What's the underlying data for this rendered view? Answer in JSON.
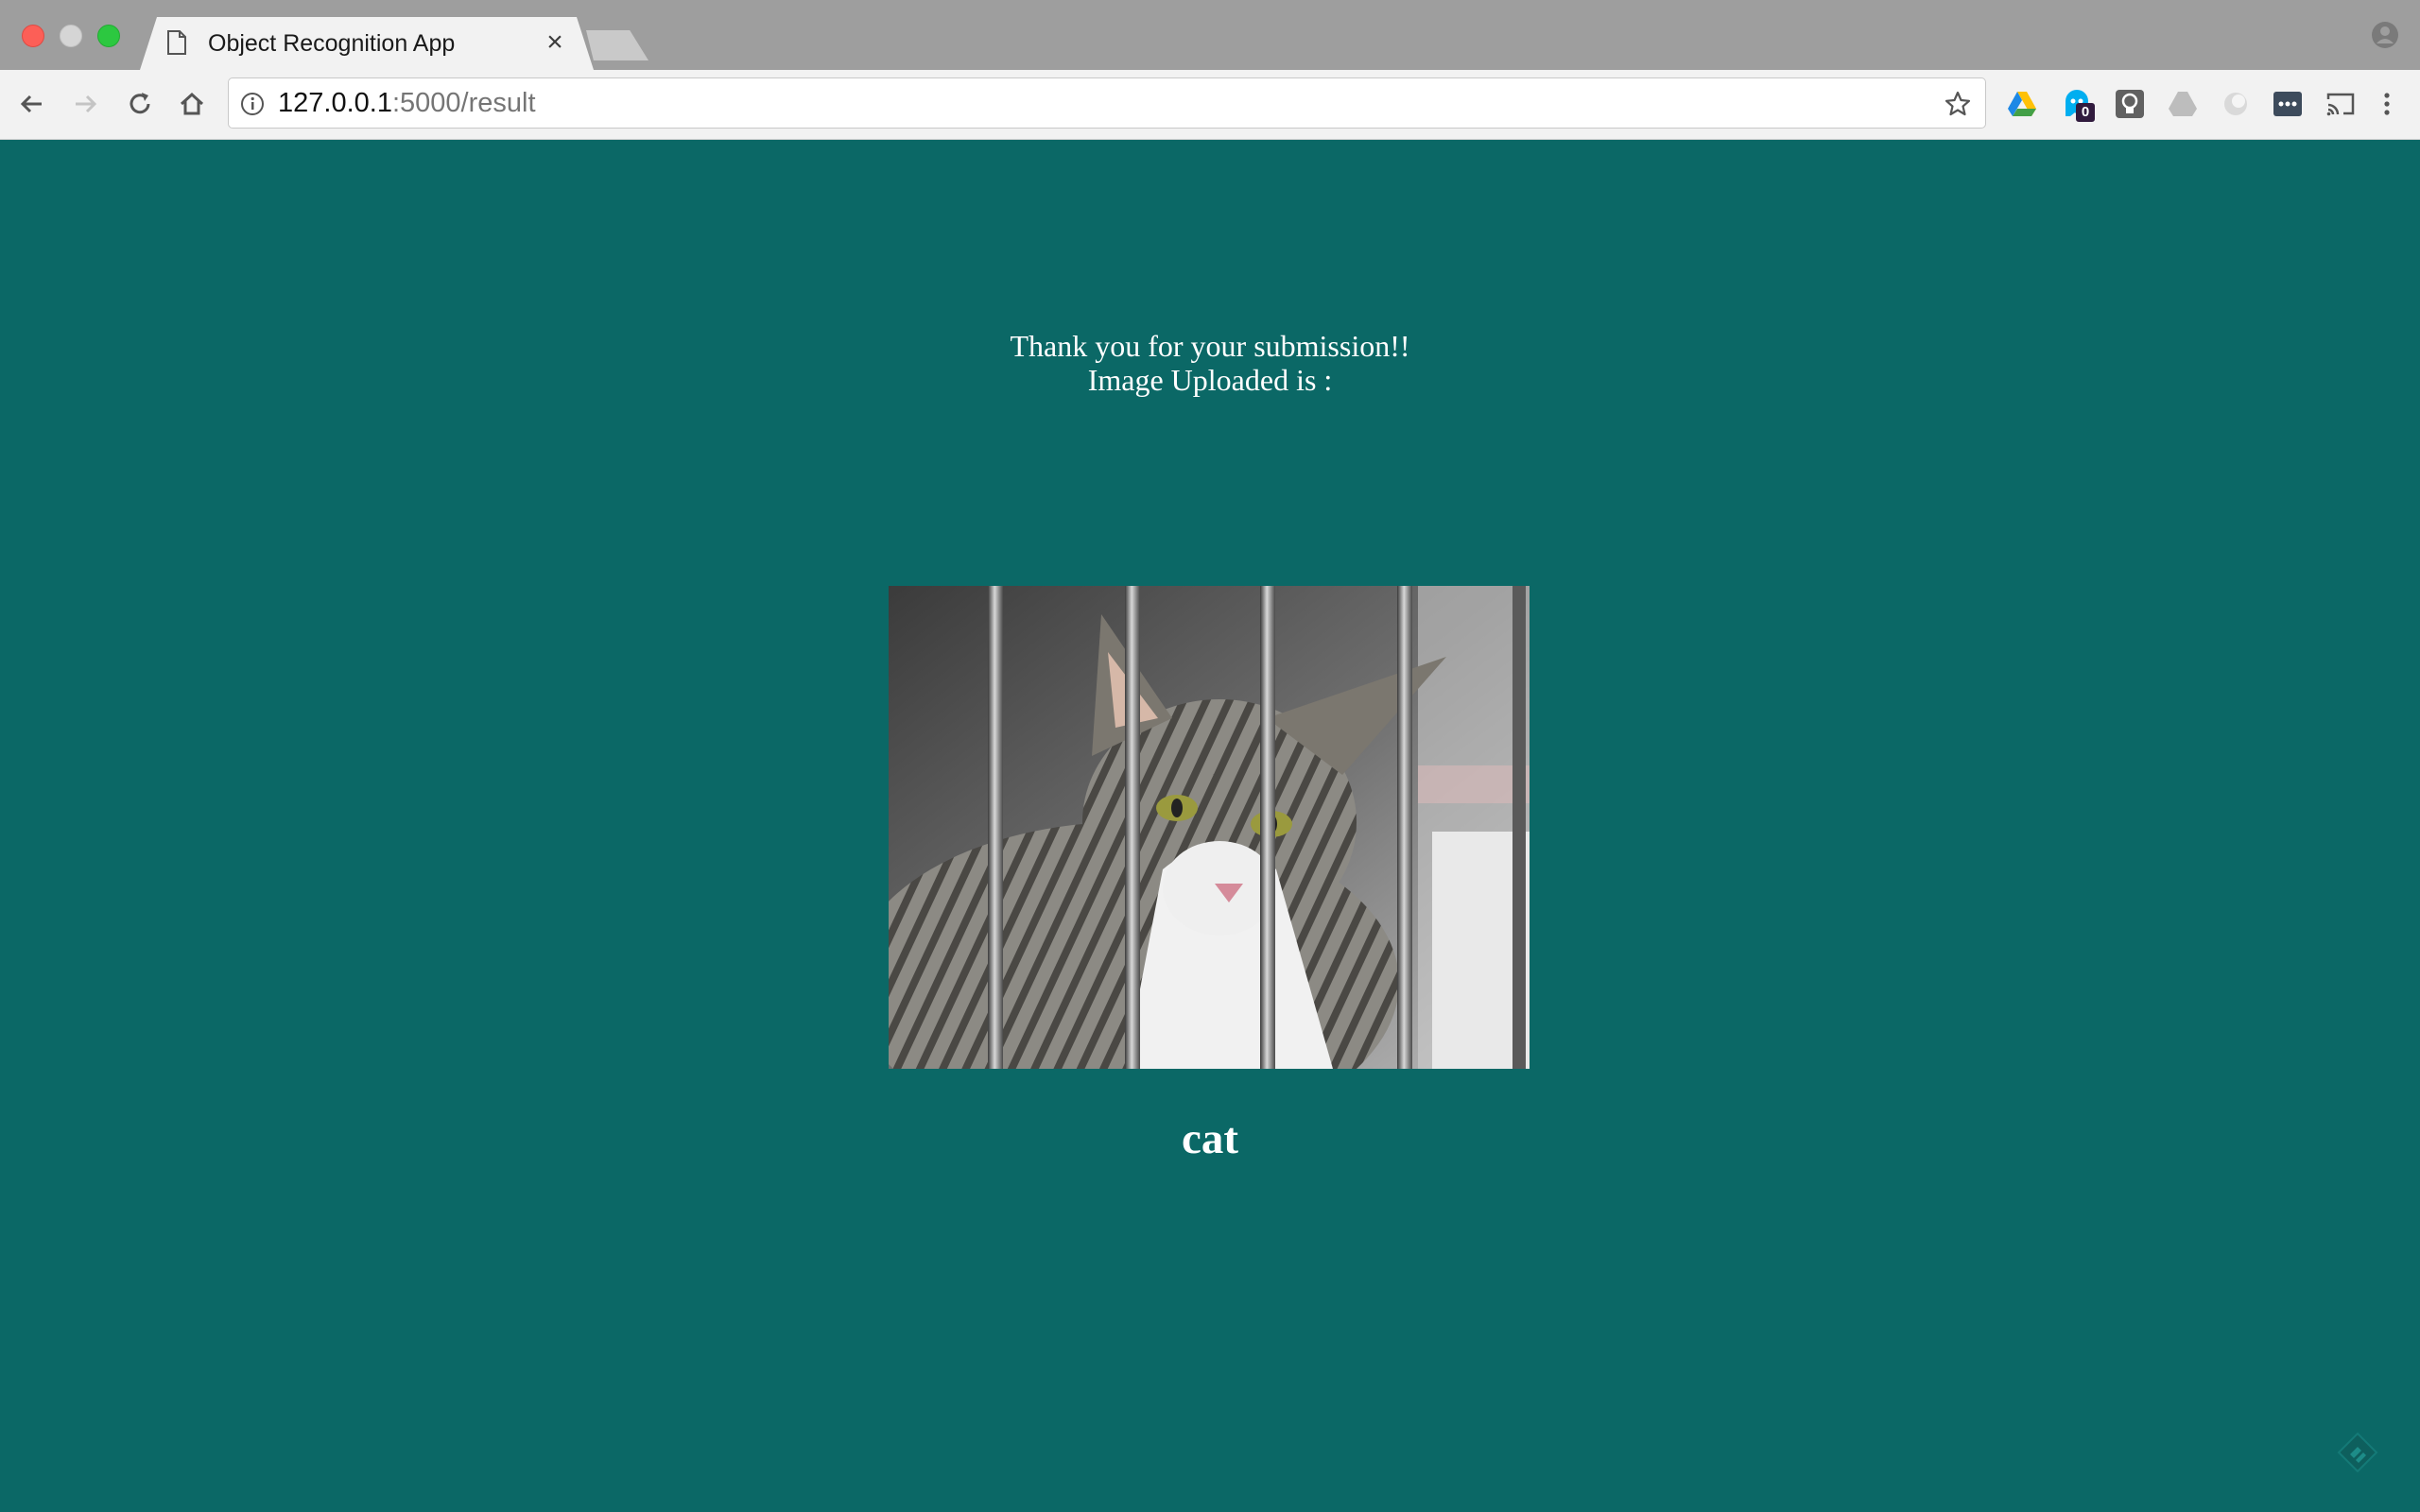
{
  "browser": {
    "tab": {
      "title": "Object Recognition App",
      "icon": "page-icon",
      "close_icon": "close-icon"
    },
    "address_bar": {
      "url_host": "127.0.0.1",
      "url_rest": ":5000/result"
    },
    "extensions": [
      {
        "icon": "google-drive-icon"
      },
      {
        "icon": "ghostery-icon",
        "badge": "0"
      },
      {
        "icon": "lightbulb-icon"
      },
      {
        "icon": "drive-grey-icon"
      },
      {
        "icon": "circle-extension-icon"
      },
      {
        "icon": "lastpass-icon"
      },
      {
        "icon": "cast-icon"
      },
      {
        "icon": "menu-icon"
      }
    ]
  },
  "page": {
    "message_line1": "Thank you for your submission!!",
    "message_line2": "Image Uploaded is :",
    "uploaded_image": "cat behind cage bars photo",
    "prediction": "cat"
  },
  "colors": {
    "page_background": "#0b6866",
    "text": "#ffffff"
  }
}
